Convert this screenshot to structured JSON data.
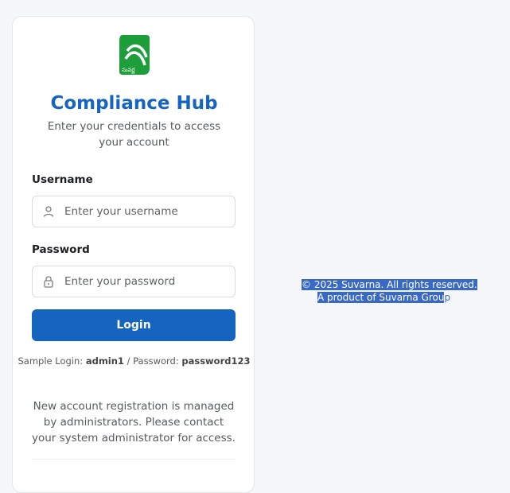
{
  "brand": {
    "title": "Compliance Hub",
    "subtitle": "Enter your credentials to access your account",
    "logo_text": "సువర్ణ",
    "logo_color": "#1e9e3a"
  },
  "form": {
    "username_label": "Username",
    "username_placeholder": "Enter your username",
    "username_icon": "user-icon",
    "password_label": "Password",
    "password_placeholder": "Enter your password",
    "password_icon": "lock-icon",
    "login_label": "Login"
  },
  "sample": {
    "prefix": "Sample Login:",
    "user": "admin1",
    "separator": "/ Password:",
    "password": "password123"
  },
  "note": "New account registration is managed by administrators. Please contact your system administrator for access.",
  "footer": {
    "copyright": "© 2025 Suvarna. All rights reserved.",
    "product_main": "A product of Suvarna Grou",
    "product_tail": "p"
  },
  "colors": {
    "accent": "#1565c0",
    "selection": "#3869c6",
    "background": "#f6f7f9"
  }
}
